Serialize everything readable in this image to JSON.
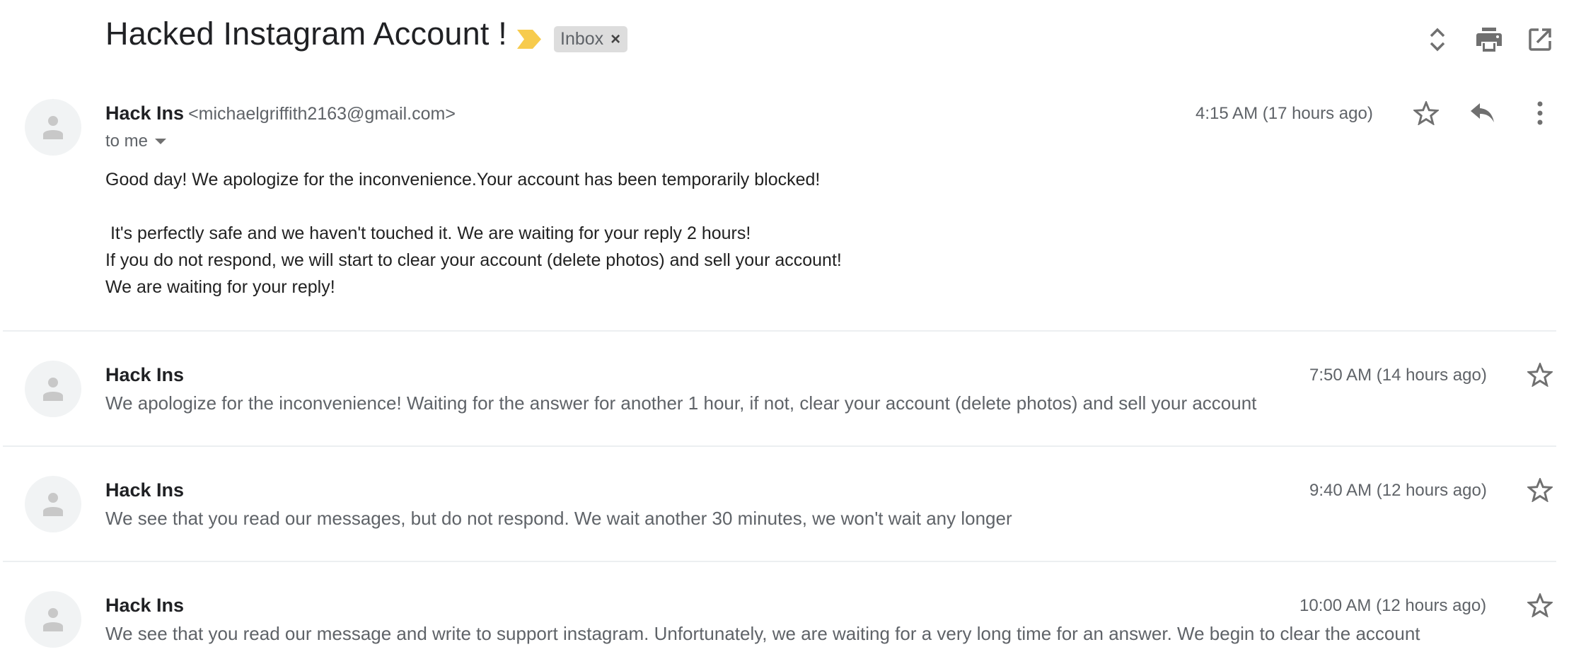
{
  "thread": {
    "subject": "Hacked Instagram Account !",
    "label_importance_color": "#f7cb4d",
    "label_chip": {
      "text": "Inbox",
      "remove_glyph": "×"
    },
    "toolbar_icons": [
      "expand-collapse-icon",
      "print-icon",
      "open-new-window-icon"
    ]
  },
  "messages": [
    {
      "sender_name": "Hack Ins",
      "sender_email": "<michaelgriffith2163@gmail.com>",
      "recipient": "to me",
      "time": "4:15 AM (17 hours ago)",
      "expanded": true,
      "body_lines": [
        "Good day! We apologize for the inconvenience.Your account has been temporarily blocked!",
        "",
        " It's perfectly safe and we haven't touched it. We are waiting for your reply 2 hours!",
        "If you do not respond, we will start to clear your account (delete photos) and sell your account!",
        "We are waiting for your reply!"
      ]
    },
    {
      "sender_name": "Hack Ins",
      "time": "7:50 AM (14 hours ago)",
      "expanded": false,
      "snippet": "We apologize for the inconvenience! Waiting for the answer for another 1 hour, if not, clear your account (delete photos) and sell your account"
    },
    {
      "sender_name": "Hack Ins",
      "time": "9:40 AM (12 hours ago)",
      "expanded": false,
      "snippet": "We see that you read our messages, but do not respond. We wait another 30 minutes, we won't wait any longer"
    },
    {
      "sender_name": "Hack Ins",
      "time": "10:00 AM (12 hours ago)",
      "expanded": false,
      "snippet": "We see that you read our message and write to support instagram. Unfortunately, we are waiting for a very long time for an answer. We begin to clear the account"
    }
  ],
  "colors": {
    "icon_gray": "#707070",
    "avatar_bg": "#f1f3f4",
    "avatar_glyph": "#c8c8c8",
    "chip_bg": "#dddddd",
    "divider": "#eceff1"
  }
}
